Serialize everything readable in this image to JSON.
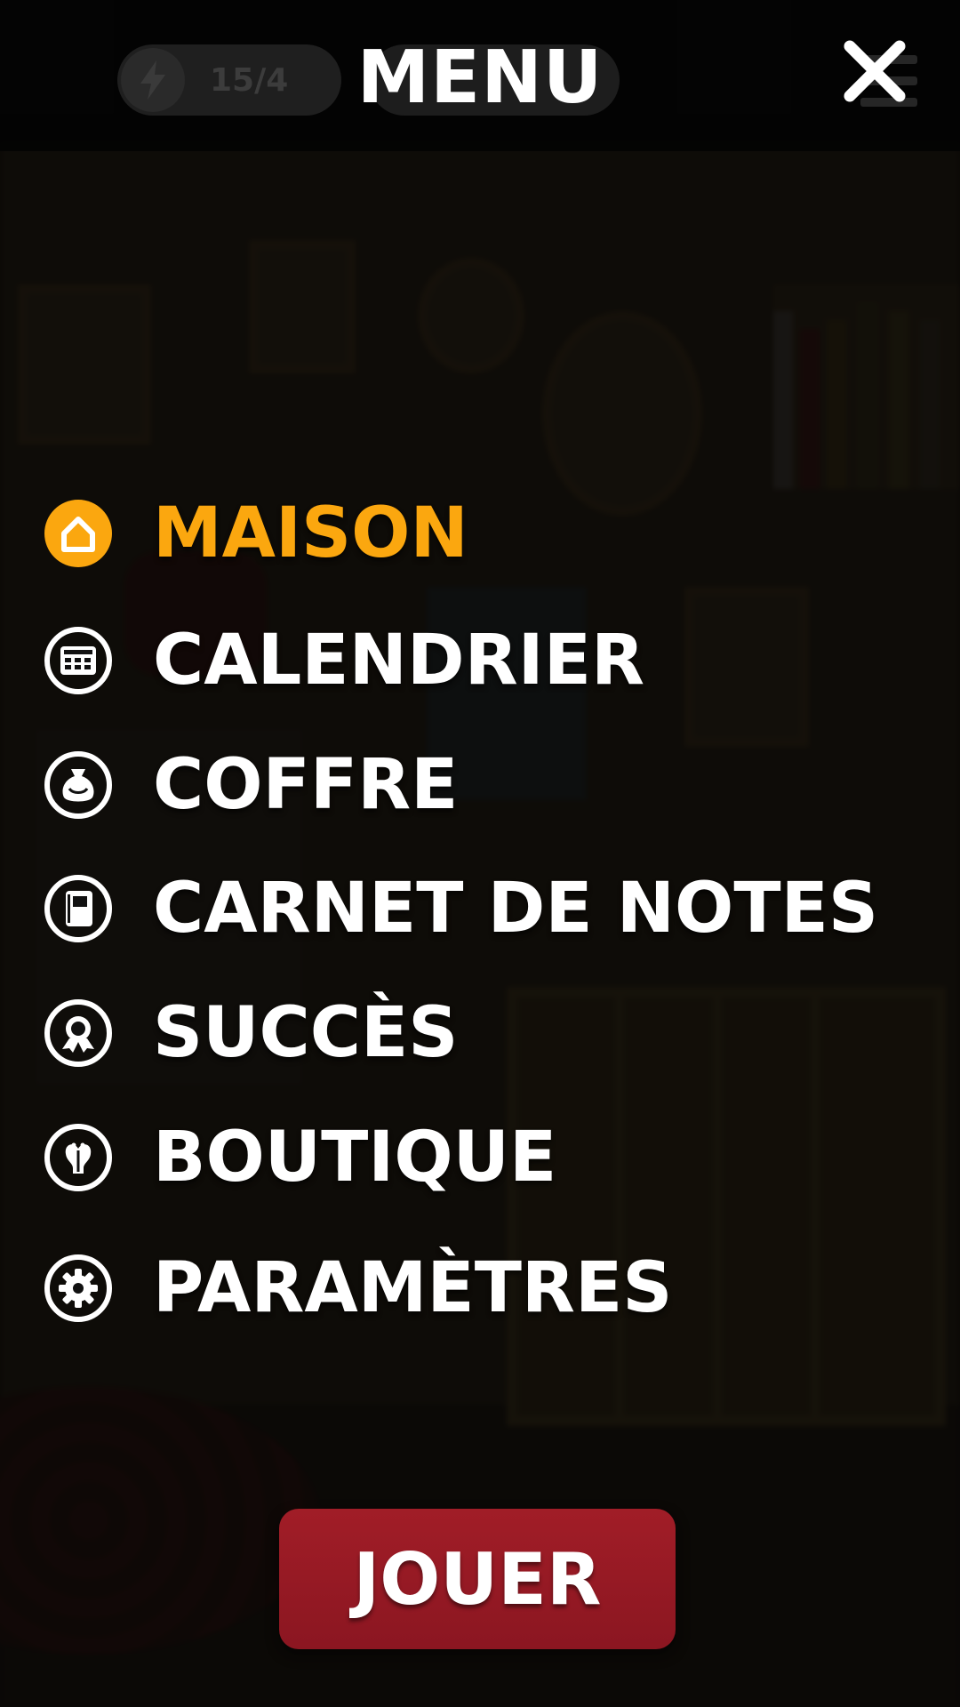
{
  "header": {
    "title": "MENU",
    "energy_count": "15/4",
    "energy_icon": "lightning-icon",
    "close_icon": "close-icon"
  },
  "menu": {
    "items": [
      {
        "label": "MAISON",
        "icon": "home-icon",
        "active": true
      },
      {
        "label": "CALENDRIER",
        "icon": "calendar-icon",
        "active": false
      },
      {
        "label": "COFFRE",
        "icon": "bag-icon",
        "active": false
      },
      {
        "label": "CARNET DE NOTES",
        "icon": "notebook-icon",
        "active": false
      },
      {
        "label": "SUCCÈS",
        "icon": "medal-icon",
        "active": false
      },
      {
        "label": "BOUTIQUE",
        "icon": "shop-icon",
        "active": false
      },
      {
        "label": "PARAMÈTRES",
        "icon": "gear-icon",
        "active": false
      }
    ]
  },
  "play_button": {
    "label": "JOUER"
  },
  "colors": {
    "accent": "#fba70f",
    "play_button": "#9b1b25",
    "text": "#ffffff"
  }
}
